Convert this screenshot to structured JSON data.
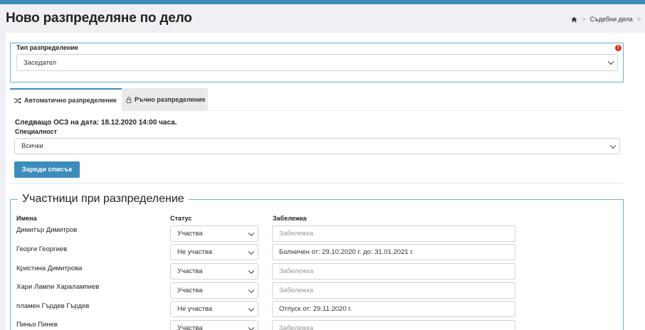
{
  "header": {
    "title": "Ново разпределяне по дело",
    "breadcrumb": {
      "home_icon": "home-icon",
      "separator": ">",
      "item": "Съдебни дела"
    }
  },
  "distribution_type": {
    "label": "Тип разпределение",
    "value": "Заседател",
    "error_icon": "alert-icon"
  },
  "tabs": [
    {
      "icon": "shuffle-icon",
      "label": "Автоматично разпределение",
      "active": true
    },
    {
      "icon": "lock-icon",
      "label": "Ръчно разпределение",
      "active": false
    }
  ],
  "auto": {
    "next_session_text": "Следващо ОСЗ на дата: 18.12.2020 14:00 часа.",
    "specialty_label": "Специалност",
    "specialty_value": "Всички",
    "load_button": "Зареди списък"
  },
  "participants": {
    "legend": "Участници при разпределение",
    "headers": {
      "name": "Имена",
      "status": "Статус",
      "note": "Забележка"
    },
    "note_placeholder": "Забележка",
    "rows": [
      {
        "name": "Димитър Димитров",
        "status": "Участва",
        "note": ""
      },
      {
        "name": "Георги Георгиев",
        "status": "Не участва",
        "note": "Болничен от: 29.10.2020 г. до: 31.01.2021 г."
      },
      {
        "name": "Кристина Димитрова",
        "status": "Участва",
        "note": ""
      },
      {
        "name": "Хари Лампи Харалампиев",
        "status": "Участва",
        "note": ""
      },
      {
        "name": "пламен Гърдев Гърдев",
        "status": "Не участва",
        "note": "Отпуск от: 29.11.2020 г."
      },
      {
        "name": "Пиньо Пинев",
        "status": "Участва",
        "note": ""
      }
    ]
  },
  "colors": {
    "accent": "#3c8dbc",
    "border_blue": "#6aaed6",
    "error": "#d93025"
  }
}
